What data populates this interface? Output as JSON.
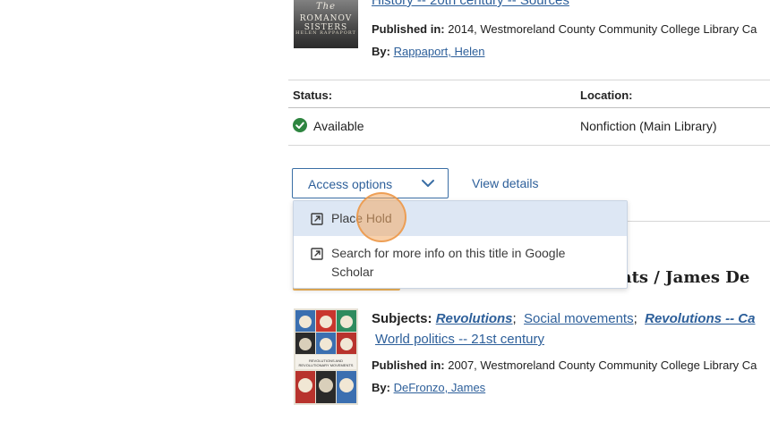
{
  "book1": {
    "cover_text": [
      "The",
      "ROMANOV SISTERS",
      "HELEN RAPPAPORT"
    ],
    "subject_link": "History -- 20th century -- Sources",
    "published_label": "Published in:",
    "published_value": "2014, Westmoreland County Community College Library Ca",
    "by_label": "By:",
    "author": "Rappaport, Helen"
  },
  "holdings": {
    "status_header": "Status:",
    "location_header": "Location:",
    "status_value": "Available",
    "location_value": "Nonfiction (Main Library)"
  },
  "actions": {
    "access_options_label": "Access options",
    "view_details_label": "View details"
  },
  "dropdown": {
    "items": [
      {
        "label": "Place Hold"
      },
      {
        "label": "Search for more info on this title in Google Scholar"
      }
    ]
  },
  "book2": {
    "title_fragment": "ments / James De",
    "cover_text": "REVOLUTIONS AND REVOLUTIONARY MOVEMENTS",
    "subjects_label": "Subjects:",
    "subjects": [
      "Revolutions",
      "Social movements",
      "Revolutions -- Ca",
      "World politics -- 21st century"
    ],
    "subject_sep": ";",
    "published_label": "Published in:",
    "published_value": "2007, Westmoreland County Community College Library Ca",
    "by_label": "By:",
    "author": "DeFronzo, James"
  },
  "colors": {
    "link": "#2d5f9a",
    "available_green": "#2e8540",
    "menu_highlight": "#dde7f4",
    "click_marker": "#f2aa64"
  }
}
